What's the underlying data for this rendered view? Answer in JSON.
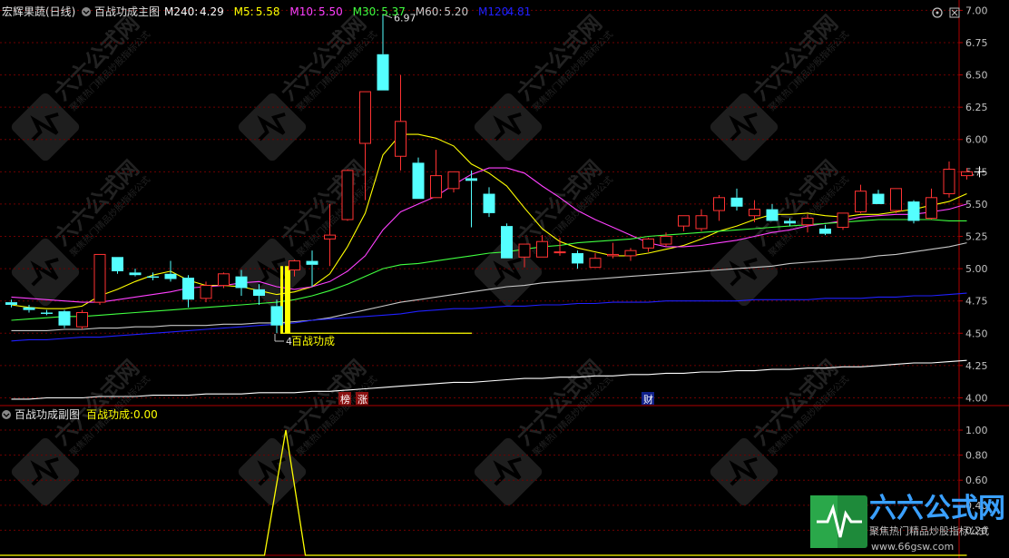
{
  "main": {
    "stock_name": "宏辉果蔬(日线)",
    "indicator_name": "百战功成主图",
    "ma_legend": [
      {
        "label": "M240:",
        "value": "4.29",
        "color": "#ffffff"
      },
      {
        "label": "M5:",
        "value": "5.58",
        "color": "#ffff00"
      },
      {
        "label": "M10:",
        "value": "5.50",
        "color": "#ff40ff"
      },
      {
        "label": "M30:",
        "value": "5.37",
        "color": "#40ff40"
      },
      {
        "label": "M60:",
        "value": "5.20",
        "color": "#c8c8c8"
      },
      {
        "label": "M120",
        "value": "4.81",
        "color": "#2020ff"
      }
    ],
    "y_ticks": [
      "7.00",
      "6.75",
      "6.50",
      "6.25",
      "6.00",
      "5.75",
      "5.50",
      "5.25",
      "5.00",
      "4.75",
      "4.50",
      "4.25",
      "4.00"
    ],
    "high_marker": "6.97",
    "low_marker": "4",
    "signal_label": "百战功成",
    "event_badges": [
      "榜",
      "涨",
      "财"
    ]
  },
  "sub": {
    "indicator_name": "百战功成副图",
    "series_label": "百战功成:",
    "series_value": "0.00",
    "y_ticks": [
      "1.00",
      "0.80",
      "0.60",
      "0.40",
      "0.20"
    ]
  },
  "watermark": {
    "brand": "六六公式网",
    "slogan": "聚焦热门精品炒股指标公式",
    "url": "www.66gsw.com"
  },
  "colors": {
    "up": "#ff3232",
    "down": "#54ffff",
    "axis": "#b00000",
    "grid": "#6e0000",
    "label": "#c0c0c0",
    "signal": "#ffff00"
  },
  "chart_data": {
    "type": "candlestick",
    "ylim": [
      3.94,
      7.08
    ],
    "candles": [
      {
        "o": 4.74,
        "h": 4.76,
        "l": 4.7,
        "c": 4.72
      },
      {
        "o": 4.7,
        "h": 4.72,
        "l": 4.66,
        "c": 4.68
      },
      {
        "o": 4.66,
        "h": 4.68,
        "l": 4.64,
        "c": 4.65
      },
      {
        "o": 4.67,
        "h": 4.68,
        "l": 4.54,
        "c": 4.56
      },
      {
        "o": 4.55,
        "h": 4.68,
        "l": 4.53,
        "c": 4.66
      },
      {
        "o": 4.74,
        "h": 5.11,
        "l": 4.72,
        "c": 5.11
      },
      {
        "o": 5.09,
        "h": 5.09,
        "l": 4.96,
        "c": 4.98
      },
      {
        "o": 4.97,
        "h": 5.0,
        "l": 4.94,
        "c": 4.95
      },
      {
        "o": 4.94,
        "h": 4.97,
        "l": 4.91,
        "c": 4.93
      },
      {
        "o": 4.96,
        "h": 5.06,
        "l": 4.9,
        "c": 4.92
      },
      {
        "o": 4.93,
        "h": 4.95,
        "l": 4.7,
        "c": 4.76
      },
      {
        "o": 4.77,
        "h": 4.9,
        "l": 4.74,
        "c": 4.87
      },
      {
        "o": 4.87,
        "h": 4.97,
        "l": 4.85,
        "c": 4.96
      },
      {
        "o": 4.94,
        "h": 4.99,
        "l": 4.79,
        "c": 4.85
      },
      {
        "o": 4.84,
        "h": 4.88,
        "l": 4.72,
        "c": 4.79
      },
      {
        "o": 4.71,
        "h": 4.76,
        "l": 4.5,
        "c": 4.56
      },
      {
        "o": 4.99,
        "h": 5.07,
        "l": 4.94,
        "c": 5.06
      },
      {
        "o": 5.06,
        "h": 5.14,
        "l": 4.86,
        "c": 5.03
      },
      {
        "o": 5.23,
        "h": 5.5,
        "l": 5.02,
        "c": 5.26
      },
      {
        "o": 5.38,
        "h": 5.77,
        "l": 5.37,
        "c": 5.76
      },
      {
        "o": 5.97,
        "h": 6.34,
        "l": 5.53,
        "c": 6.37
      },
      {
        "o": 6.66,
        "h": 6.97,
        "l": 6.38,
        "c": 6.38
      },
      {
        "o": 5.87,
        "h": 6.5,
        "l": 5.76,
        "c": 6.14
      },
      {
        "o": 5.82,
        "h": 5.86,
        "l": 5.54,
        "c": 5.54
      },
      {
        "o": 5.55,
        "h": 5.92,
        "l": 5.55,
        "c": 5.72
      },
      {
        "o": 5.62,
        "h": 5.75,
        "l": 5.59,
        "c": 5.75
      },
      {
        "o": 5.7,
        "h": 5.76,
        "l": 5.32,
        "c": 5.68
      },
      {
        "o": 5.58,
        "h": 5.63,
        "l": 5.4,
        "c": 5.43
      },
      {
        "o": 5.33,
        "h": 5.35,
        "l": 5.08,
        "c": 5.08
      },
      {
        "o": 5.09,
        "h": 5.16,
        "l": 5.01,
        "c": 5.19
      },
      {
        "o": 5.09,
        "h": 5.26,
        "l": 5.09,
        "c": 5.21
      },
      {
        "o": 5.13,
        "h": 5.24,
        "l": 5.1,
        "c": 5.13
      },
      {
        "o": 5.12,
        "h": 5.14,
        "l": 5.0,
        "c": 5.04
      },
      {
        "o": 5.01,
        "h": 5.12,
        "l": 5.01,
        "c": 5.08
      },
      {
        "o": 5.1,
        "h": 5.2,
        "l": 5.08,
        "c": 5.11
      },
      {
        "o": 5.1,
        "h": 5.16,
        "l": 5.06,
        "c": 5.14
      },
      {
        "o": 5.16,
        "h": 5.24,
        "l": 5.13,
        "c": 5.23
      },
      {
        "o": 5.19,
        "h": 5.28,
        "l": 5.17,
        "c": 5.25
      },
      {
        "o": 5.33,
        "h": 5.41,
        "l": 5.29,
        "c": 5.41
      },
      {
        "o": 5.31,
        "h": 5.46,
        "l": 5.29,
        "c": 5.41
      },
      {
        "o": 5.45,
        "h": 5.57,
        "l": 5.37,
        "c": 5.55
      },
      {
        "o": 5.55,
        "h": 5.62,
        "l": 5.45,
        "c": 5.48
      },
      {
        "o": 5.41,
        "h": 5.53,
        "l": 5.36,
        "c": 5.46
      },
      {
        "o": 5.46,
        "h": 5.5,
        "l": 5.37,
        "c": 5.37
      },
      {
        "o": 5.37,
        "h": 5.39,
        "l": 5.33,
        "c": 5.35
      },
      {
        "o": 5.34,
        "h": 5.42,
        "l": 5.28,
        "c": 5.39
      },
      {
        "o": 5.31,
        "h": 5.34,
        "l": 5.26,
        "c": 5.27
      },
      {
        "o": 5.32,
        "h": 5.43,
        "l": 5.3,
        "c": 5.43
      },
      {
        "o": 5.44,
        "h": 5.65,
        "l": 5.43,
        "c": 5.6
      },
      {
        "o": 5.58,
        "h": 5.61,
        "l": 5.5,
        "c": 5.5
      },
      {
        "o": 5.45,
        "h": 5.62,
        "l": 5.43,
        "c": 5.62
      },
      {
        "o": 5.52,
        "h": 5.53,
        "l": 5.35,
        "c": 5.37
      },
      {
        "o": 5.39,
        "h": 5.62,
        "l": 5.38,
        "c": 5.55
      },
      {
        "o": 5.58,
        "h": 5.83,
        "l": 5.55,
        "c": 5.77
      },
      {
        "o": 5.72,
        "h": 5.78,
        "l": 5.69,
        "c": 5.75
      }
    ],
    "ma_lines": [
      {
        "name": "M5",
        "color": "#ffff00",
        "values": [
          4.72,
          4.7,
          4.69,
          4.69,
          4.71,
          4.79,
          4.84,
          4.9,
          4.95,
          4.98,
          4.91,
          4.87,
          4.87,
          4.86,
          4.83,
          4.8,
          4.82,
          4.86,
          4.96,
          5.17,
          5.43,
          5.88,
          6.04,
          6.04,
          6.01,
          5.95,
          5.81,
          5.74,
          5.64,
          5.47,
          5.31,
          5.21,
          5.16,
          5.13,
          5.1,
          5.1,
          5.12,
          5.15,
          5.18,
          5.23,
          5.29,
          5.33,
          5.38,
          5.42,
          5.42,
          5.43,
          5.41,
          5.4,
          5.42,
          5.42,
          5.44,
          5.46,
          5.49,
          5.52,
          5.58
        ]
      },
      {
        "name": "M10",
        "color": "#ff40ff",
        "values": [
          4.78,
          4.77,
          4.76,
          4.75,
          4.74,
          4.74,
          4.76,
          4.78,
          4.8,
          4.82,
          4.85,
          4.86,
          4.87,
          4.89,
          4.9,
          4.86,
          4.84,
          4.86,
          4.9,
          4.98,
          5.1,
          5.3,
          5.44,
          5.5,
          5.56,
          5.65,
          5.73,
          5.78,
          5.78,
          5.74,
          5.64,
          5.55,
          5.45,
          5.38,
          5.32,
          5.26,
          5.2,
          5.17,
          5.17,
          5.18,
          5.2,
          5.22,
          5.25,
          5.28,
          5.3,
          5.33,
          5.35,
          5.37,
          5.4,
          5.41,
          5.42,
          5.42,
          5.44,
          5.46,
          5.5
        ]
      },
      {
        "name": "M30",
        "color": "#40ff40",
        "values": [
          4.6,
          4.61,
          4.62,
          4.63,
          4.63,
          4.64,
          4.65,
          4.66,
          4.67,
          4.68,
          4.69,
          4.7,
          4.71,
          4.72,
          4.73,
          4.74,
          4.76,
          4.79,
          4.83,
          4.88,
          4.94,
          5.0,
          5.03,
          5.04,
          5.06,
          5.08,
          5.1,
          5.12,
          5.13,
          5.15,
          5.17,
          5.18,
          5.2,
          5.21,
          5.22,
          5.23,
          5.25,
          5.26,
          5.27,
          5.28,
          5.29,
          5.3,
          5.31,
          5.32,
          5.33,
          5.34,
          5.35,
          5.36,
          5.37,
          5.38,
          5.38,
          5.38,
          5.38,
          5.37,
          5.37
        ]
      },
      {
        "name": "M60",
        "color": "#c8c8c8",
        "values": [
          4.52,
          4.52,
          4.52,
          4.53,
          4.53,
          4.54,
          4.54,
          4.55,
          4.55,
          4.56,
          4.56,
          4.56,
          4.57,
          4.57,
          4.58,
          4.58,
          4.59,
          4.6,
          4.62,
          4.65,
          4.68,
          4.71,
          4.74,
          4.76,
          4.78,
          4.8,
          4.82,
          4.84,
          4.86,
          4.87,
          4.89,
          4.9,
          4.91,
          4.92,
          4.93,
          4.94,
          4.95,
          4.96,
          4.97,
          4.98,
          4.99,
          5.0,
          5.01,
          5.02,
          5.04,
          5.05,
          5.06,
          5.07,
          5.08,
          5.1,
          5.11,
          5.13,
          5.15,
          5.17,
          5.2
        ]
      },
      {
        "name": "M120",
        "color": "#2020ff",
        "values": [
          4.44,
          4.45,
          4.45,
          4.46,
          4.47,
          4.47,
          4.48,
          4.49,
          4.5,
          4.51,
          4.52,
          4.53,
          4.54,
          4.55,
          4.56,
          4.57,
          4.58,
          4.6,
          4.61,
          4.62,
          4.63,
          4.64,
          4.65,
          4.67,
          4.68,
          4.69,
          4.69,
          4.7,
          4.71,
          4.71,
          4.72,
          4.72,
          4.73,
          4.73,
          4.74,
          4.74,
          4.74,
          4.75,
          4.75,
          4.75,
          4.75,
          4.75,
          4.76,
          4.76,
          4.76,
          4.76,
          4.77,
          4.77,
          4.77,
          4.78,
          4.78,
          4.79,
          4.79,
          4.8,
          4.81
        ]
      },
      {
        "name": "M240",
        "color": "#ffffff",
        "values": [
          3.99,
          3.99,
          4.0,
          4.0,
          4.0,
          4.01,
          4.01,
          4.01,
          4.02,
          4.02,
          4.02,
          4.03,
          4.03,
          4.03,
          4.04,
          4.04,
          4.04,
          4.05,
          4.05,
          4.06,
          4.07,
          4.08,
          4.09,
          4.1,
          4.11,
          4.12,
          4.12,
          4.13,
          4.14,
          4.15,
          4.15,
          4.16,
          4.16,
          4.17,
          4.17,
          4.18,
          4.18,
          4.19,
          4.19,
          4.2,
          4.2,
          4.21,
          4.21,
          4.22,
          4.22,
          4.23,
          4.23,
          4.24,
          4.24,
          4.25,
          4.26,
          4.27,
          4.27,
          4.28,
          4.29
        ]
      }
    ],
    "signal_index": 15,
    "signal_level": 4.5,
    "sub_series": {
      "name": "百战功成",
      "values": [
        0,
        0,
        0,
        0,
        0,
        0,
        0,
        0,
        0,
        0,
        0,
        0,
        0,
        0,
        0,
        1,
        0,
        0,
        0,
        0,
        0,
        0,
        0,
        0,
        0,
        0,
        0,
        0,
        0,
        0,
        0,
        0,
        0,
        0,
        0,
        0,
        0,
        0,
        0,
        0,
        0,
        0,
        0,
        0,
        0,
        0,
        0,
        0,
        0,
        0,
        0,
        0,
        0,
        0,
        0
      ]
    },
    "sub_ylim": [
      0,
      1.08
    ]
  }
}
